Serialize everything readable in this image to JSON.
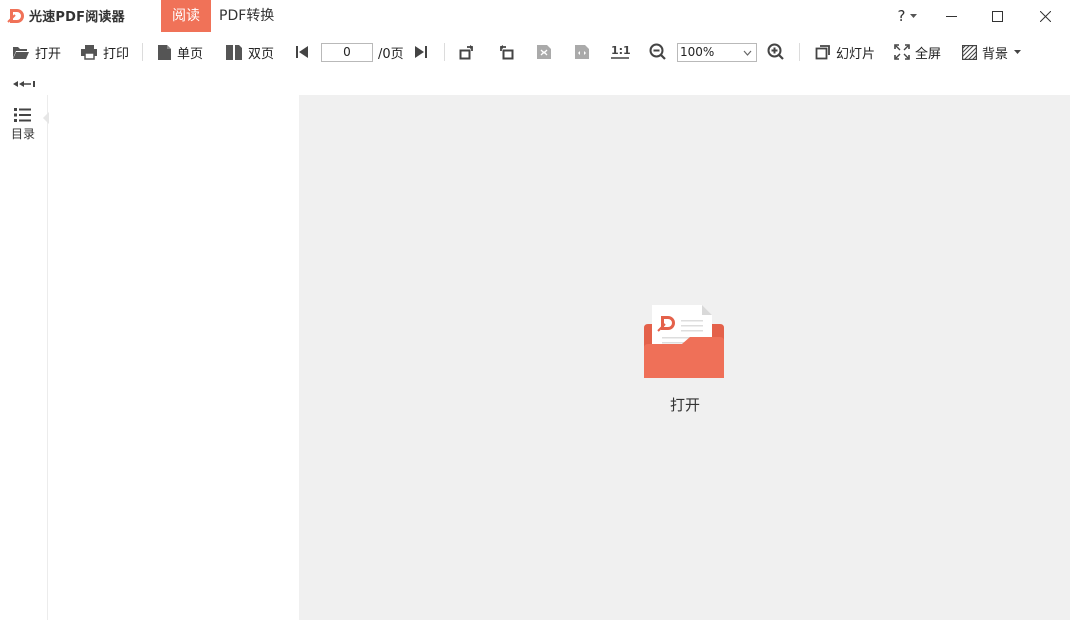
{
  "app": {
    "title": "光速PDF阅读器",
    "brand_color": "#f07258"
  },
  "tabs": [
    {
      "label": "阅读",
      "active": true
    },
    {
      "label": "PDF转换",
      "active": false
    }
  ],
  "window_controls": {
    "help": "?",
    "help_icon": "question-icon",
    "minimize_icon": "minimize-icon",
    "maximize_icon": "maximize-icon",
    "close_icon": "close-icon"
  },
  "toolbar": {
    "open": "打开",
    "print": "打印",
    "single_page": "单页",
    "double_page": "双页",
    "page_current": "0",
    "page_total": "/0页",
    "zoom": "100%",
    "slideshow": "幻灯片",
    "fullscreen": "全屏",
    "background": "背景"
  },
  "sidebar": {
    "toc_label": "目录"
  },
  "main": {
    "open_label": "打开"
  }
}
